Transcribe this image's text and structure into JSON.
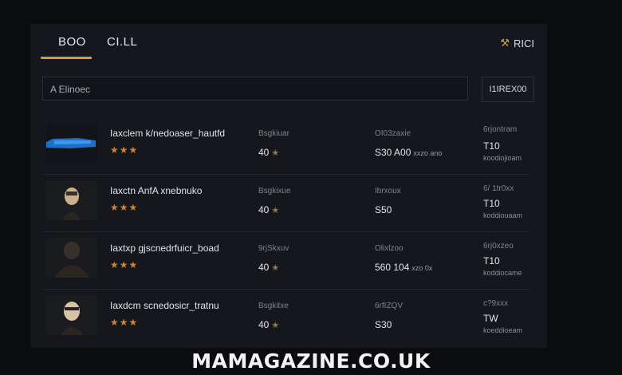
{
  "tabs": [
    {
      "label": "BOO"
    },
    {
      "label": "CI.LL"
    }
  ],
  "rank": {
    "label": "RICI",
    "icon": "badge-icon"
  },
  "search": {
    "value": "A Elinoec"
  },
  "filter_button": {
    "label": "I1IREX00"
  },
  "rows": [
    {
      "title": "Iaxclem k/nedoaser_hautfd",
      "rating": "★★★",
      "col1_label": "Bsgkiuar",
      "col1_value": "40",
      "col2_label": "OI03zaxie",
      "col2_value": "S30 A00",
      "col2_minor": "xxzo ano",
      "col3_label": "6rjontram",
      "col3_value": "T10",
      "col3_sub": "koodiojioam",
      "thumb": "blue-vehicle-image"
    },
    {
      "title": "Iaxctn AnfA xnebnuko",
      "rating": "★★★",
      "col1_label": "Bsgkixue",
      "col1_value": "40",
      "col2_label": "Ibrxoux",
      "col2_value": "S50",
      "col2_minor": "",
      "col3_label": "6/ 1tr0xx",
      "col3_value": "T10",
      "col3_sub": "koddiouaam",
      "thumb": "masked-figure-image"
    },
    {
      "title": "Iaxtxp gjscnedrfuicr_boad",
      "rating": "★★★",
      "col1_label": "9rjSkxuv",
      "col1_value": "40",
      "col2_label": "Olixlzoo",
      "col2_value": "560 104",
      "col2_minor": "xzo 0x",
      "col3_label": "6rj0xzeo",
      "col3_value": "T10",
      "col3_sub": "koddiocame",
      "thumb": "hooded-figure-image"
    },
    {
      "title": "Iaxdcm scnedosicr_tratnu",
      "rating": "★★★",
      "col1_label": "Bsgkitxe",
      "col1_value": "40",
      "col2_label": "6rfIZQV",
      "col2_value": "S30",
      "col2_minor": "",
      "col3_label": "c?9xxx",
      "col3_value": "TW",
      "col3_sub": "koeddioeam",
      "thumb": "skull-mask-image"
    }
  ],
  "footer": {
    "text": "MAMAGAZINE.CO.UK"
  },
  "colors": {
    "accent": "#d99a3d",
    "stars": "#d9802e",
    "background": "#0b0c10",
    "panel": "#15171c"
  }
}
